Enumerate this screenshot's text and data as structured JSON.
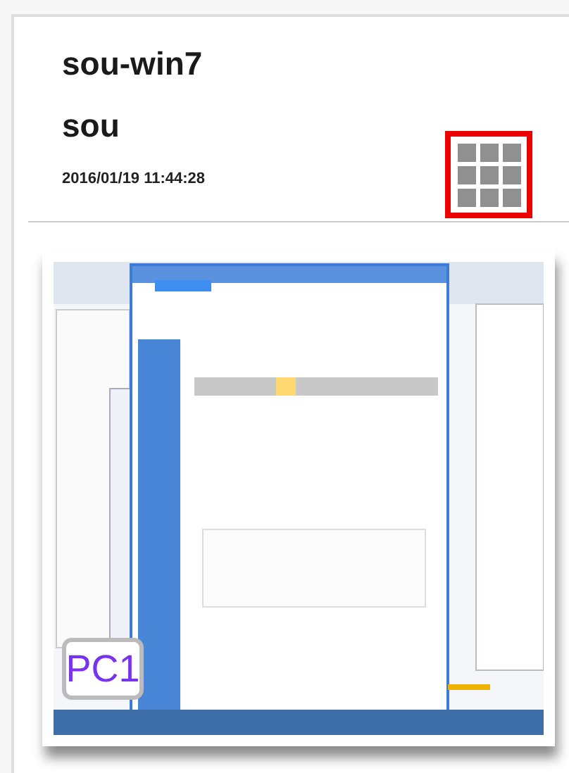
{
  "card": {
    "title": "sou-win7",
    "user": "sou",
    "timestamp": "2016/01/19 11:44:28",
    "grid_button": {
      "selected": true
    },
    "thumbnail": {
      "badge": "PC1"
    }
  }
}
